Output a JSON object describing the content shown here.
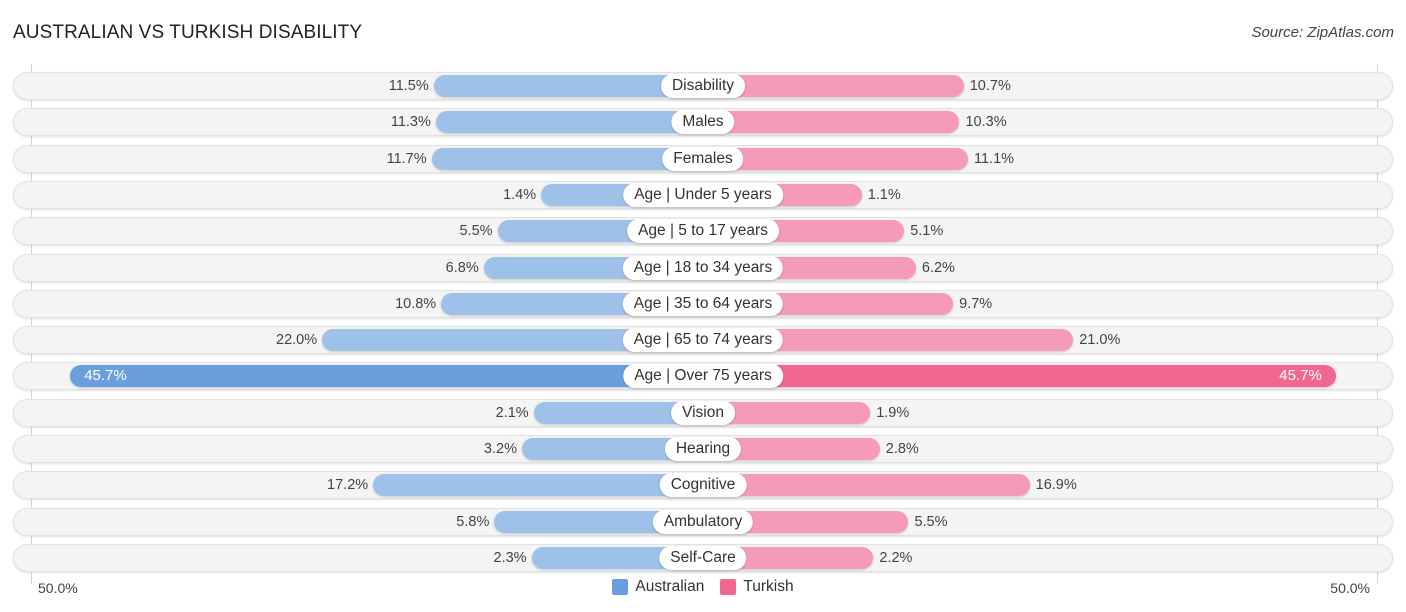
{
  "header": {
    "title": "AUSTRALIAN VS TURKISH DISABILITY",
    "source": "Source: ZipAtlas.com"
  },
  "colors": {
    "australian": "#6a9fdc",
    "australian_light": "#9dc1e8",
    "turkish": "#f06791",
    "turkish_light": "#f59ab7"
  },
  "chart_data": {
    "type": "bar",
    "orientation": "horizontal-diverging",
    "title": "AUSTRALIAN VS TURKISH DISABILITY",
    "xlabel": "",
    "ylabel": "",
    "axis_min_label": "50.0%",
    "axis_max_label": "50.0%",
    "xlim": [
      0,
      50
    ],
    "legend_position": "bottom-center",
    "categories": [
      "Disability",
      "Males",
      "Females",
      "Age | Under 5 years",
      "Age | 5 to 17 years",
      "Age | 18 to 34 years",
      "Age | 35 to 64 years",
      "Age | 65 to 74 years",
      "Age | Over 75 years",
      "Vision",
      "Hearing",
      "Cognitive",
      "Ambulatory",
      "Self-Care"
    ],
    "series": [
      {
        "name": "Australian",
        "values": [
          11.5,
          11.3,
          11.7,
          1.4,
          5.5,
          6.8,
          10.8,
          22.0,
          45.7,
          2.1,
          3.2,
          17.2,
          5.8,
          2.3
        ],
        "labels": [
          "11.5%",
          "11.3%",
          "11.7%",
          "1.4%",
          "5.5%",
          "6.8%",
          "10.8%",
          "22.0%",
          "45.7%",
          "2.1%",
          "3.2%",
          "17.2%",
          "5.8%",
          "2.3%"
        ]
      },
      {
        "name": "Turkish",
        "values": [
          10.7,
          10.3,
          11.1,
          1.1,
          5.1,
          6.2,
          9.7,
          21.0,
          45.7,
          1.9,
          2.8,
          16.9,
          5.5,
          2.2
        ],
        "labels": [
          "10.7%",
          "10.3%",
          "11.1%",
          "1.1%",
          "5.1%",
          "6.2%",
          "9.7%",
          "21.0%",
          "45.7%",
          "1.9%",
          "2.8%",
          "16.9%",
          "5.5%",
          "2.2%"
        ]
      }
    ]
  },
  "legend": {
    "items": [
      {
        "label": "Australian"
      },
      {
        "label": "Turkish"
      }
    ]
  }
}
